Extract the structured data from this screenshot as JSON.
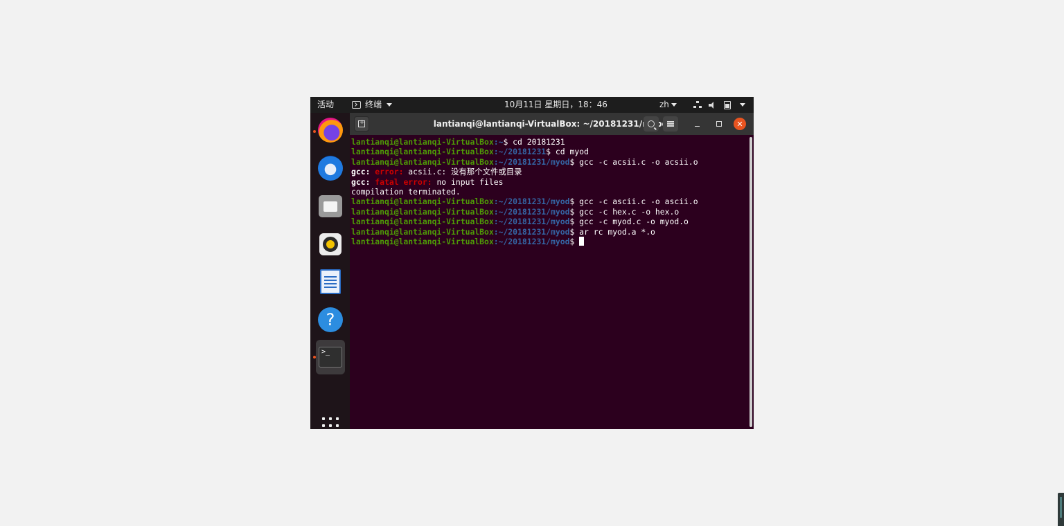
{
  "topbar": {
    "activities": "活动",
    "app_menu": "终端",
    "clock": "10月11日 星期日，18：46",
    "lang": "zh"
  },
  "dock": {
    "items": [
      "firefox-icon",
      "thunderbird-icon",
      "files-icon",
      "rhythmbox-icon",
      "writer-icon",
      "help-icon",
      "terminal-icon"
    ],
    "terminal_glyph": ">_",
    "help_glyph": "?"
  },
  "window": {
    "title": "lantianqi@lantianqi-VirtualBox: ~/20181231/myod",
    "accent_close": "#e95420"
  },
  "terminal": {
    "user_host": "lantianqi@lantianqi-VirtualBox",
    "lines": [
      {
        "path": ":~",
        "cmd": "$ cd 20181231"
      },
      {
        "path": ":~/20181231",
        "cmd": "$ cd myod"
      },
      {
        "path": ":~/20181231/myod",
        "cmd": "$ gcc -c acsii.c -o acsii.o"
      },
      {
        "gcc": "gcc:",
        "kind": " error:",
        "msg": " acsii.c: 没有那个文件或目录"
      },
      {
        "gcc": "gcc:",
        "kind": " fatal error:",
        "msg": " no input files"
      },
      {
        "plain": "compilation terminated."
      },
      {
        "path": ":~/20181231/myod",
        "cmd": "$ gcc -c ascii.c -o ascii.o"
      },
      {
        "path": ":~/20181231/myod",
        "cmd": "$ gcc -c hex.c -o hex.o"
      },
      {
        "path": ":~/20181231/myod",
        "cmd": "$ gcc -c myod.c -o myod.o"
      },
      {
        "path": ":~/20181231/myod",
        "cmd": "$ ar rc myod.a *.o"
      },
      {
        "path": ":~/20181231/myod",
        "cmd": "$ "
      }
    ]
  }
}
